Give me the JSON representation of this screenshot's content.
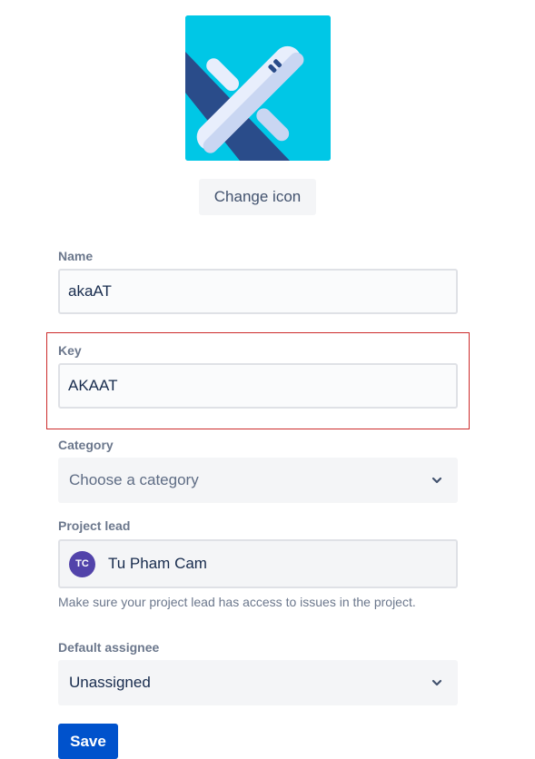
{
  "project_icon": {
    "icon": "airplane-icon",
    "background_color": "#00c7e6"
  },
  "change_icon_label": "Change icon",
  "fields": {
    "name": {
      "label": "Name",
      "value": "akaAT"
    },
    "key": {
      "label": "Key",
      "value": "AKAAT"
    },
    "category": {
      "label": "Category",
      "placeholder": "Choose a category"
    },
    "project_lead": {
      "label": "Project lead",
      "avatar_initials": "TC",
      "value": "Tu Pham Cam",
      "helper": "Make sure your project lead has access to issues in the project."
    },
    "default_assignee": {
      "label": "Default assignee",
      "value": "Unassigned"
    }
  },
  "save_label": "Save",
  "colors": {
    "primary": "#0052cc",
    "avatar": "#5243aa",
    "highlight": "#cc2b2b"
  }
}
